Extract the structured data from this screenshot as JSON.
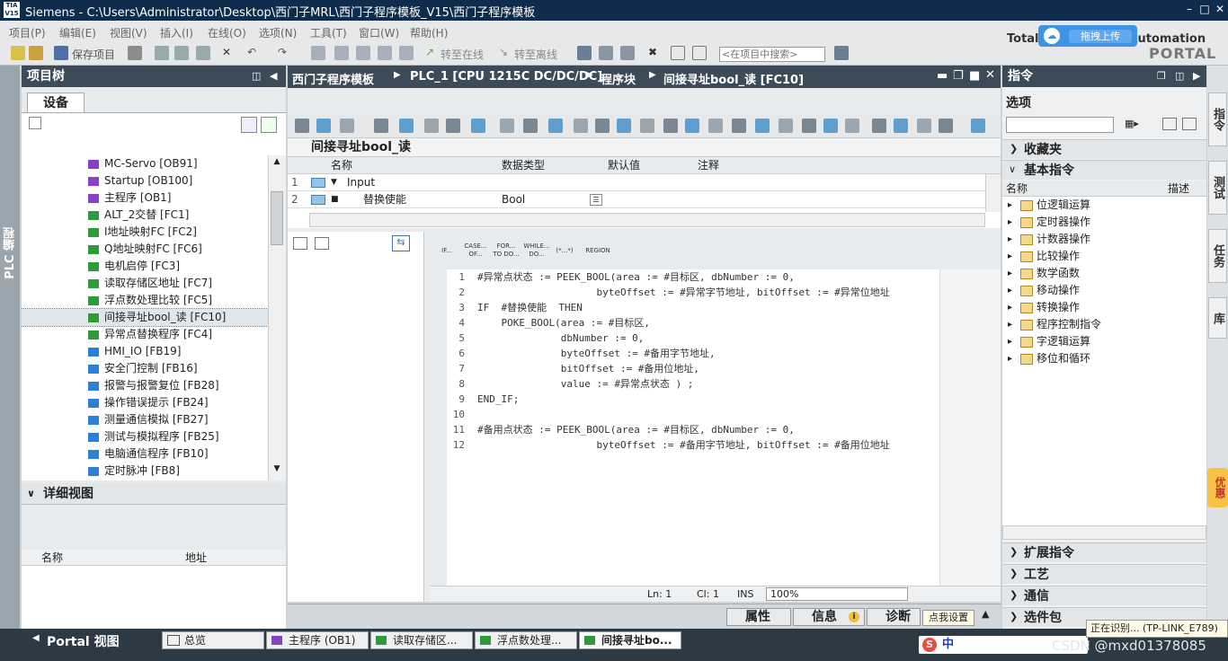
{
  "titlebar": {
    "logo": "TIA V15",
    "text": "Siemens   -   C:\\Users\\Administrator\\Desktop\\西门子MRL\\西门子程序模板_V15\\西门子程序模板"
  },
  "menu": [
    "项目(P)",
    "编辑(E)",
    "视图(V)",
    "插入(I)",
    "在线(O)",
    "选项(N)",
    "工具(T)",
    "窗口(W)",
    "帮助(H)"
  ],
  "toolbar": {
    "save_project": "保存项目",
    "go_online": "转至在线",
    "go_offline": "转至离线",
    "search_placeholder": "<在项目中搜索>"
  },
  "branding": {
    "line1": "Totally Integrated Automation",
    "line2": "PORTAL",
    "upload_button": "拖拽上传"
  },
  "left_sidebar": {
    "label": "PLC 编程"
  },
  "project_tree": {
    "title": "项目树",
    "tab": "设备",
    "items": [
      {
        "label": "MC-Servo [OB91]",
        "type": "ob"
      },
      {
        "label": "Startup [OB100]",
        "type": "ob"
      },
      {
        "label": "主程序 [OB1]",
        "type": "ob"
      },
      {
        "label": "ALT_2交替 [FC1]",
        "type": "fc"
      },
      {
        "label": "I地址映射FC [FC2]",
        "type": "fc"
      },
      {
        "label": "Q地址映射FC [FC6]",
        "type": "fc"
      },
      {
        "label": "电机启停 [FC3]",
        "type": "fc"
      },
      {
        "label": "读取存储区地址 [FC7]",
        "type": "fc"
      },
      {
        "label": "浮点数处理比较 [FC5]",
        "type": "fc"
      },
      {
        "label": "间接寻址bool_读 [FC10]",
        "type": "fc",
        "selected": true
      },
      {
        "label": "异常点替换程序 [FC4]",
        "type": "fc"
      },
      {
        "label": "HMI_IO [FB19]",
        "type": "fb"
      },
      {
        "label": "安全门控制 [FB16]",
        "type": "fb"
      },
      {
        "label": "报警与报警复位 [FB28]",
        "type": "fb"
      },
      {
        "label": "操作错误提示 [FB24]",
        "type": "fb"
      },
      {
        "label": "测量通信模拟 [FB27]",
        "type": "fb"
      },
      {
        "label": "测试与模拟程序 [FB25]",
        "type": "fb"
      },
      {
        "label": "电脑通信程序 [FB10]",
        "type": "fb"
      },
      {
        "label": "定时脉冲 [FB8]",
        "type": "fb"
      }
    ]
  },
  "detail_view": {
    "title": "详细视图",
    "col_name": "名称",
    "col_address": "地址"
  },
  "editor": {
    "breadcrumb": [
      "西门子程序模板",
      "PLC_1 [CPU 1215C DC/DC/DC]",
      "程序块",
      "间接寻址bool_读 [FC10]"
    ],
    "block_title": "间接寻址bool_读",
    "iface_headers": [
      "名称",
      "数据类型",
      "默认值",
      "注释"
    ],
    "iface_rows": [
      {
        "num": "1",
        "name": "Input",
        "type": "",
        "default": "",
        "comment": ""
      },
      {
        "num": "2",
        "name": "替换使能",
        "type": "Bool",
        "default": "",
        "comment": ""
      }
    ],
    "scl_buttons": [
      "IF...",
      "CASE... OF...",
      "FOR... TO DO...",
      "WHILE... DO...",
      "(*...*)",
      "REGION"
    ],
    "code_lines": [
      {
        "n": "1",
        "t": "#异常点状态 := PEEK_BOOL(area := #目标区, dbNumber := 0,"
      },
      {
        "n": "2",
        "t": "                    byteOffset := #异常字节地址, bitOffset := #异常位地址"
      },
      {
        "n": "3",
        "t": "IF  #替换使能  THEN"
      },
      {
        "n": "4",
        "t": "    POKE_BOOL(area := #目标区,"
      },
      {
        "n": "5",
        "t": "              dbNumber := 0,"
      },
      {
        "n": "6",
        "t": "              byteOffset := #备用字节地址,"
      },
      {
        "n": "7",
        "t": "              bitOffset := #备用位地址,"
      },
      {
        "n": "8",
        "t": "              value := #异常点状态 ) ;"
      },
      {
        "n": "9",
        "t": "END_IF;"
      },
      {
        "n": "10",
        "t": ""
      },
      {
        "n": "11",
        "t": "#备用点状态 := PEEK_BOOL(area := #目标区, dbNumber := 0,"
      },
      {
        "n": "12",
        "t": "                    byteOffset := #备用字节地址, bitOffset := #备用位地址"
      }
    ],
    "status": {
      "ln": "Ln: 1",
      "cl": "Cl: 1",
      "mode": "INS",
      "zoom": "100%"
    }
  },
  "bottom_tabs": {
    "properties": "属性",
    "info": "信息",
    "diagnostics": "诊断",
    "tooltip": "点我设置"
  },
  "instructions": {
    "title": "指令",
    "options_label": "选项",
    "favorites": "收藏夹",
    "basic": "基本指令",
    "col_name": "名称",
    "col_desc": "描述",
    "items": [
      "位逻辑运算",
      "定时器操作",
      "计数器操作",
      "比较操作",
      "数学函数",
      "移动操作",
      "转换操作",
      "程序控制指令",
      "字逻辑运算",
      "移位和循环"
    ],
    "extended": "扩展指令",
    "technology": "工艺",
    "communication": "通信",
    "option_packages": "选件包"
  },
  "right_tabs": [
    "指令",
    "测试",
    "任务",
    "库"
  ],
  "promo": "优惠",
  "taskbar": {
    "portal_view": "Portal 视图",
    "tasks": [
      "总览",
      "主程序 (OB1)",
      "读取存储区...",
      "浮点数处理...",
      "间接寻址bo..."
    ],
    "notification": "正在识别... (TP-LINK_E789)",
    "ime": "中",
    "watermark": "CSDN @mxd01378085"
  },
  "colors": {
    "ob": "#8a3fc7",
    "fc": "#2e9a3a",
    "fb": "#2d7fd6",
    "header": "#3c4b57"
  }
}
